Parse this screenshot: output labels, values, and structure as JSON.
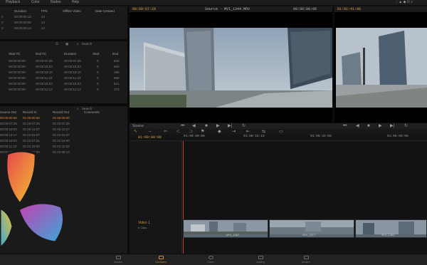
{
  "menubar": {
    "items": [
      "Playback",
      "Color",
      "Nodes",
      "Help"
    ]
  },
  "clip_table": {
    "headers": [
      "Duration",
      "FPS",
      "Offline Video",
      "Date Created"
    ],
    "rows": [
      {
        "a": "0",
        "b": "00:00:00:13",
        "c": "24"
      },
      {
        "a": "0",
        "b": "00:00:00:00",
        "c": "24"
      },
      {
        "a": "0",
        "b": "00:00:00:13",
        "c": "24"
      }
    ]
  },
  "edit_table": {
    "search": "Search",
    "headers": [
      "Start TC",
      "End TC",
      "Duration",
      "Start",
      "End"
    ],
    "rows": [
      [
        "00:00:00:00",
        "00:00:07:29",
        "00:00:07:29",
        "0",
        "820"
      ],
      [
        "00:00:00:00",
        "00:00:18:03",
        "00:00:18:03",
        "0",
        "900"
      ],
      [
        "00:00:00:00",
        "00:00:18:10",
        "00:00:18:10",
        "0",
        "480"
      ],
      [
        "00:00:00:00",
        "00:00:11:23",
        "00:00:11:23",
        "0",
        "880"
      ],
      [
        "00:00:00:00",
        "00:00:18:03",
        "00:00:18:03",
        "0",
        "521"
      ],
      [
        "00:00:00:00",
        "00:00:12:14",
        "00:00:12:14",
        "0",
        "373"
      ]
    ]
  },
  "record_table": {
    "search": "Search",
    "headers": [
      "Source Out",
      "Record In",
      "Record Out",
      "Comments"
    ],
    "rows": [
      [
        "00:00:00:00",
        "01:00:00:00",
        "01:00:00:00"
      ],
      [
        "00:00:07:29",
        "01:00:07:29",
        "01:00:07:29"
      ],
      [
        "00:00:18:03",
        "01:00:41:07",
        "01:00:41:07"
      ],
      [
        "00:00:14:17",
        "01:01:01:07",
        "01:01:01:07"
      ],
      [
        "00:00:18:03",
        "01:01:07:01",
        "01:01:16:00"
      ],
      [
        "00:00:11:23",
        "01:01:16:00",
        "01:01:41:02"
      ],
      [
        "00:00:12:14",
        "01:01:41:02",
        "01:02:08:13"
      ]
    ]
  },
  "source_viewer": {
    "left_tc": "00:00:07:29",
    "title": "Source - MVI_1344.MOV",
    "right_tc": "00:00:00:00"
  },
  "record_viewer": {
    "tc": "01:01:41:00"
  },
  "timeline": {
    "source_label": "Source",
    "current_tc": "01:00:00:00",
    "ruler": [
      "01:00:00:00",
      "01:00:16:16",
      "01:00:33:08",
      "01:00:50:00"
    ],
    "track": {
      "name": "Video 1",
      "clips_label": "6 Clips"
    },
    "clips": [
      "MVI_1367",
      "MVI_1317",
      "MVI_1360"
    ]
  },
  "bottom_nav": {
    "items": [
      {
        "label": "Media"
      },
      {
        "label": "Conform"
      },
      {
        "label": "Color"
      },
      {
        "label": "Gallery"
      },
      {
        "label": "Deliver"
      }
    ],
    "active_index": 1
  },
  "colors": {
    "accent": "#d98a2c",
    "logo_red": "#e8454e",
    "logo_yellow": "#f2c230",
    "logo_blue": "#3aa8d8",
    "logo_magenta": "#c43fb0"
  }
}
